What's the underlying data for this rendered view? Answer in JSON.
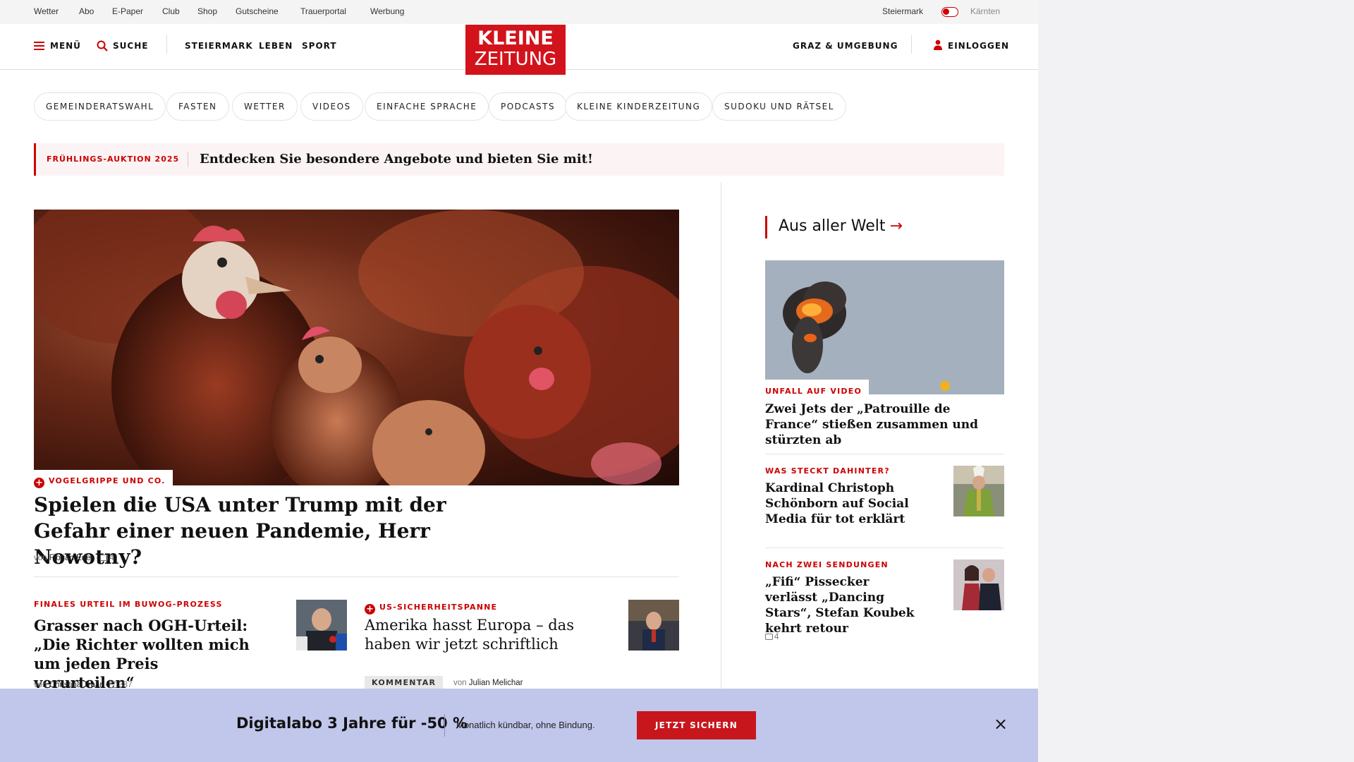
{
  "utility_bar": {
    "links": [
      "Wetter",
      "Abo",
      "E-Paper",
      "Club",
      "Shop",
      "Gutscheine",
      "Trauerportal",
      "Werbung"
    ],
    "region_left": "Steiermark",
    "region_right": "Kärnten"
  },
  "header": {
    "menu_label": "MENÜ",
    "search_label": "SUCHE",
    "nav": [
      "STEIERMARK",
      "LEBEN",
      "SPORT"
    ],
    "logo_line1": "KLEINE",
    "logo_line2": "ZEITUNG",
    "region_link": "GRAZ & UMGEBUNG",
    "login_label": "EINLOGGEN"
  },
  "topics": [
    "GEMEINDERATSWAHL",
    "FASTEN",
    "WETTER",
    "VIDEOS",
    "EINFACHE SPRACHE",
    "PODCASTS",
    "KLEINE KINDERZEITUNG",
    "SUDOKU UND RÄTSEL"
  ],
  "promo": {
    "tag": "FRÜHLINGS-AUKTION 2025",
    "text": "Entdecken Sie besondere Angebote und bieten Sie mit!"
  },
  "hero": {
    "kicker": "VOGELGRIPPE UND CO.",
    "title": "Spielen die USA unter Trump mit der Gefahr einer neuen Pandemie, Herr Nowotny?",
    "by": "von",
    "author": "Florian Eder",
    "comments": "4"
  },
  "teasers": [
    {
      "kicker": "FINALES URTEIL IM BUWOG-PROZESS",
      "title": "Grasser nach OGH-Urteil: „Die Richter wollten mich um jeden Preis verurteilen“",
      "by": "von",
      "author": "Christina Traar",
      "comments": "387"
    },
    {
      "kicker": "US-SICHERHEITSPANNE",
      "title": "Amerika hasst Europa – das haben wir jetzt schriftlich",
      "label": "KOMMENTAR",
      "by": "von",
      "author": "Julian Melichar"
    }
  ],
  "sidebar": {
    "heading": "Aus aller Welt",
    "items": [
      {
        "kicker": "UNFALL AUF VIDEO",
        "title": "Zwei Jets der „Patrouille de France“ stießen zusammen und stürzten ab"
      },
      {
        "kicker": "WAS STECKT DAHINTER?",
        "title": "Kardinal Christoph Schönborn auf Social Media für tot erklärt"
      },
      {
        "kicker": "NACH ZWEI SENDUNGEN",
        "title": "„Fifi“ Pissecker verlässt „Dancing Stars“, Stefan Koubek kehrt retour",
        "comments": "4"
      }
    ]
  },
  "offer_bar": {
    "headline": "Digitalabo 3 Jahre für -50 %",
    "subtext": "Monatlich kündbar, ohne Bindung.",
    "button": "JETZT SICHERN"
  },
  "colors": {
    "brand_red": "#d3131c",
    "offer_bg": "#c1c6eb"
  }
}
